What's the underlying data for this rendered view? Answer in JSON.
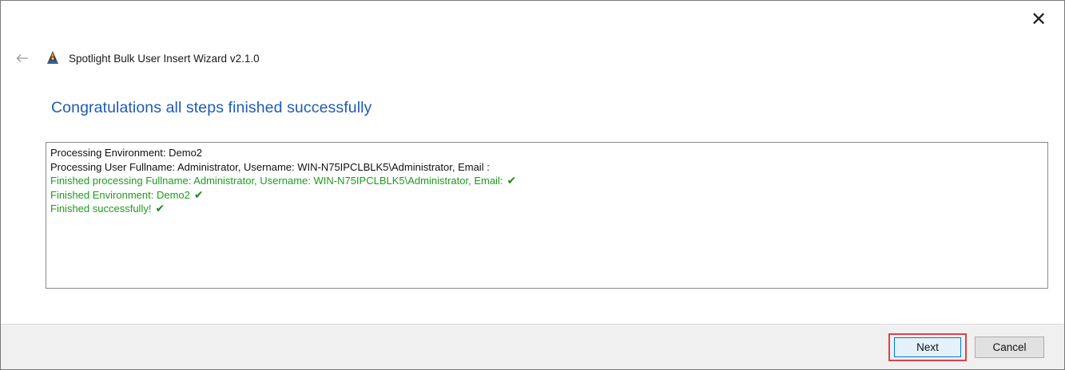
{
  "window": {
    "close_glyph": "✕",
    "title": "Spotlight Bulk User Insert Wizard v2.1.0"
  },
  "page": {
    "heading": "Congratulations all steps finished successfully"
  },
  "log": {
    "lines": [
      {
        "text": "Processing Environment: Demo2",
        "status": "normal"
      },
      {
        "text": "Processing User Fullname: Administrator, Username: WIN-N75IPCLBLK5\\Administrator, Email :",
        "status": "normal"
      },
      {
        "text": "Finished processing Fullname: Administrator, Username: WIN-N75IPCLBLK5\\Administrator, Email:",
        "status": "success",
        "check": true
      },
      {
        "text": "Finished Environment: Demo2",
        "status": "success",
        "check": true
      },
      {
        "text": "Finished successfully!",
        "status": "success",
        "check": true
      }
    ],
    "check_glyph": "✔"
  },
  "footer": {
    "next_label": "Next",
    "cancel_label": "Cancel"
  },
  "colors": {
    "heading": "#1e5bb5",
    "success_text": "#1e9b1e",
    "highlight_border": "#d9434b"
  },
  "icons": {
    "back": "back-arrow-icon",
    "app": "spotlight-app-icon",
    "close": "close-icon",
    "check": "checkmark-icon"
  }
}
